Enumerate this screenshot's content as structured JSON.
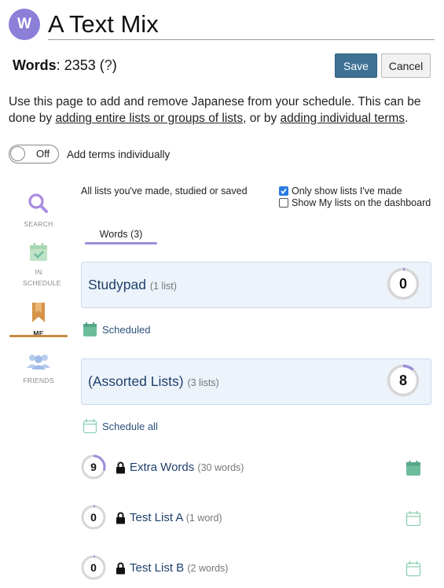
{
  "header": {
    "avatar_letter": "W",
    "title": "A Text Mix"
  },
  "words": {
    "label": "Words",
    "separator": ": ",
    "count": "2353",
    "help_open": " (",
    "help": "?",
    "help_close": ")"
  },
  "buttons": {
    "save": "Save",
    "cancel": "Cancel"
  },
  "intro": {
    "part1": "Use this page to add and remove Japanese from your schedule. This can be done by ",
    "link1": "adding entire lists or groups of lists",
    "part2": ", or by ",
    "link2": "adding individual terms",
    "part3": "."
  },
  "toggle": {
    "state_text": "Off",
    "label": "Add terms individually"
  },
  "sidebar": {
    "items": [
      {
        "label": "SEARCH",
        "icon": "search-icon"
      },
      {
        "label": "IN SCHEDULE",
        "icon": "calendar-check-icon"
      },
      {
        "label": "ME",
        "icon": "bookmark-icon",
        "active": true
      },
      {
        "label": "FRIENDS",
        "icon": "friends-icon"
      }
    ]
  },
  "filters": {
    "description": "All lists you've made, studied or saved",
    "only_mine": {
      "label": "Only show lists I've made",
      "checked": true
    },
    "dashboard": {
      "label": "Show My lists on the dashboard",
      "checked": false
    }
  },
  "tab": {
    "label": "Words (3)"
  },
  "groups": [
    {
      "title": "Studypad",
      "sub": "(1 list)",
      "count": "0",
      "progress": 0.02,
      "schedule_label": "Scheduled",
      "scheduled": true
    },
    {
      "title": "(Assorted Lists)",
      "sub": "(3 lists)",
      "count": "8",
      "progress": 0.12,
      "schedule_label": "Schedule all",
      "scheduled": false
    }
  ],
  "lists": [
    {
      "name": "Extra Words",
      "count_text": "(30 words)",
      "learned": "9",
      "progress": 0.3,
      "scheduled": true
    },
    {
      "name": "Test List A",
      "count_text": "(1 word)",
      "learned": "0",
      "progress": 0.02,
      "scheduled": false
    },
    {
      "name": "Test List B",
      "count_text": "(2 words)",
      "learned": "0",
      "progress": 0.02,
      "scheduled": false
    }
  ],
  "colors": {
    "accent_purple": "#8b7fd8",
    "save_blue": "#3e7295",
    "scheduled_green": "#6dbd9c",
    "me_orange": "#c98a3e"
  }
}
